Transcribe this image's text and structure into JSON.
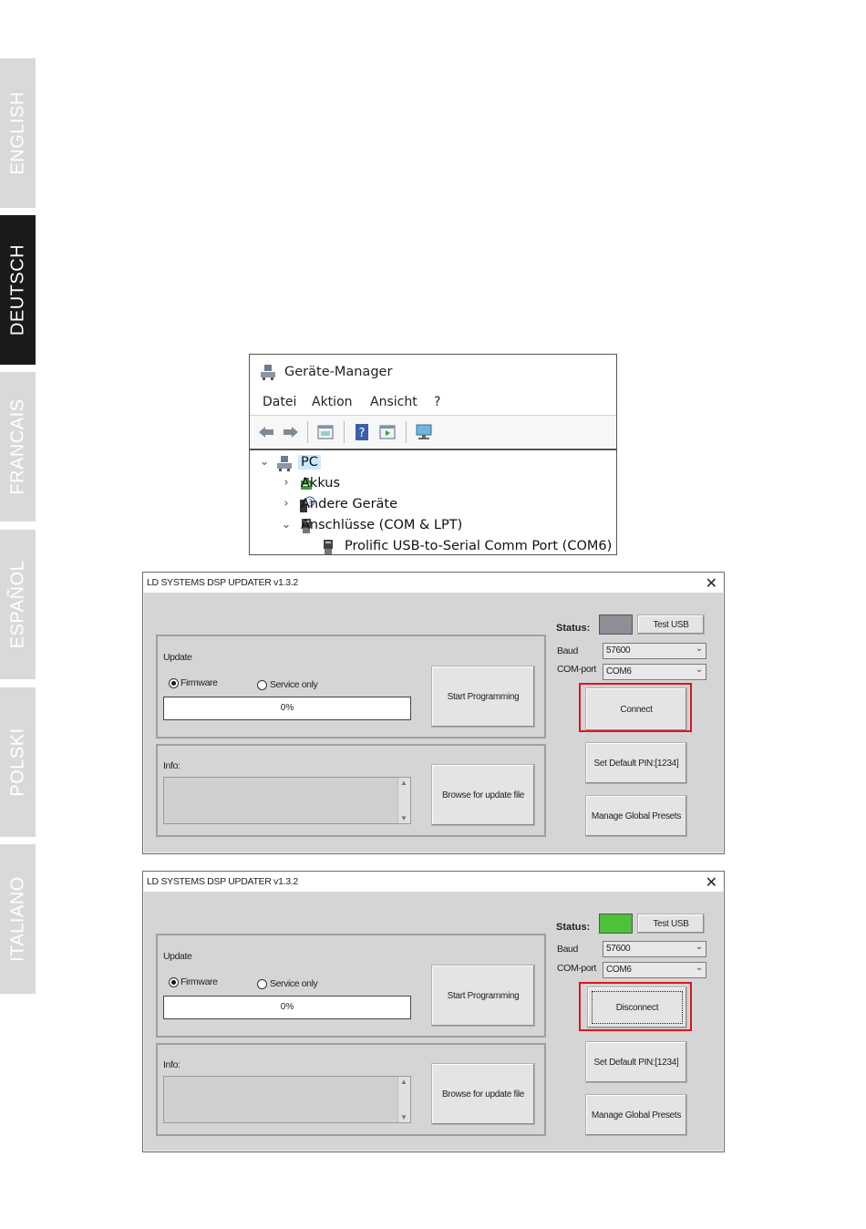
{
  "language_tabs": [
    {
      "label": "ENGLISH",
      "active": false
    },
    {
      "label": "DEUTSCH",
      "active": true
    },
    {
      "label": "FRANCAIS",
      "active": false
    },
    {
      "label": "ESPAÑOL",
      "active": false
    },
    {
      "label": "POLSKI",
      "active": false
    },
    {
      "label": "ITALIANO",
      "active": false
    }
  ],
  "device_manager": {
    "title": "Geräte-Manager",
    "menu": [
      "Datei",
      "Aktion",
      "Ansicht",
      "?"
    ],
    "tree": [
      {
        "label": "PC",
        "icon": "computer-icon",
        "expanded": true
      },
      {
        "label": "Akkus",
        "icon": "battery-icon",
        "expanded": false
      },
      {
        "label": "Andere Geräte",
        "icon": "unknown-device-icon",
        "expanded": false
      },
      {
        "label": "Anschlüsse (COM & LPT)",
        "icon": "port-icon",
        "expanded": true
      },
      {
        "label": "Prolific USB-to-Serial Comm Port (COM6)",
        "icon": "port-icon"
      }
    ]
  },
  "updater_windows": [
    {
      "title": "LD SYSTEMS DSP UPDATER v1.3.2",
      "close": "✕",
      "status_label": "Status:",
      "status_color": "#8e8e96",
      "test_usb": "Test USB",
      "baud_label": "Baud",
      "baud_value": "57600",
      "com_label": "COM-port",
      "com_value": "COM6",
      "connect_button": "Connect",
      "update_label": "Update",
      "firmware_label": "Firmware",
      "service_label": "Service only",
      "progress_text": "0%",
      "start_button": "Start Programming",
      "info_label": "Info:",
      "browse_button": "Browse for update file",
      "pin_button": "Set Default PIN:[1234]",
      "presets_button": "Manage Global Presets",
      "highlight_color": "#e0141e"
    },
    {
      "title": "LD SYSTEMS DSP UPDATER v1.3.2",
      "close": "✕",
      "status_label": "Status:",
      "status_color": "#4cc23a",
      "test_usb": "Test USB",
      "baud_label": "Baud",
      "baud_value": "57600",
      "com_label": "COM-port",
      "com_value": "COM6",
      "connect_button": "Disconnect",
      "update_label": "Update",
      "firmware_label": "Firmware",
      "service_label": "Service only",
      "progress_text": "0%",
      "start_button": "Start Programming",
      "info_label": "Info:",
      "browse_button": "Browse for update file",
      "pin_button": "Set Default PIN:[1234]",
      "presets_button": "Manage Global Presets",
      "highlight_color": "#e0141e"
    }
  ]
}
